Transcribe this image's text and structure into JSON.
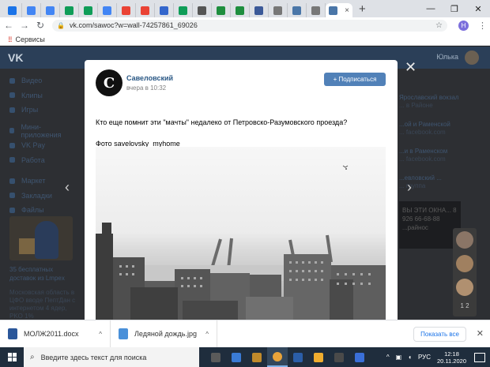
{
  "browser": {
    "tab_close": "×",
    "new_tab": "+",
    "tab_favicons": [
      "#1a73e8",
      "#4285f4",
      "#4285f4",
      "#0f9d58",
      "#0f9d58",
      "#4285f4",
      "#ea4335",
      "#ea4335",
      "#3366cc",
      "#0f9d58",
      "#555555",
      "#1e8e3e",
      "#1e8e3e",
      "#3b5998",
      "#777777",
      "#4a76a8",
      "#777777",
      "#4a76a8"
    ],
    "address": "vk.com/sawoc?w=wall-74257861_69026",
    "bookmarks_label": "Сервисы",
    "profile_initial": "Н",
    "minimize": "—",
    "restore": "❐",
    "close": "✕",
    "back": "←",
    "forward": "→",
    "reload": "↻"
  },
  "vk": {
    "logo": "VK",
    "user_name": "Юлька",
    "sidebar": [
      "Видео",
      "Клипы",
      "Игры",
      "Мини-приложения",
      "VK Pay",
      "Работа",
      "Маркет",
      "Закладки",
      "Файлы"
    ],
    "promo_title": "35 бесплатных доставок из Lmpex",
    "promo_text": "Московская область в ЦФО вводе ПептДан с интернетом 4 ядер, PKO 1%",
    "right_items": [
      {
        "title": "Ярославский вокзал",
        "desc": "... в Районе"
      },
      {
        "title": "...ой и Раменской",
        "desc": "... facebook.com"
      },
      {
        "title": "...и в Раменском",
        "desc": "... facebook.com"
      },
      {
        "title": "...евловский ...",
        "desc": "... группа"
      }
    ],
    "ad_text": "ВЫ ЭТИ ОКНА... 8 926 66-68-88 ...райнос",
    "friends_count": "1 2"
  },
  "post": {
    "author": "Савеловский",
    "time": "вчера в 10:32",
    "subscribe_label": "Подписаться",
    "text_line1": "Кто еще помнит эти \"мачты\" недалеко от Петровско-Разумовского проезда?",
    "text_line2": "Фото savelovsky_myhome",
    "avatar_letter": "C"
  },
  "downloads": {
    "items": [
      {
        "name": "МОЛЖ2011.docx",
        "color": "#2b579a"
      },
      {
        "name": "Ледяной дождь.jpg",
        "color": "#4a90d9"
      }
    ],
    "show_all": "Показать все",
    "close": "✕"
  },
  "taskbar": {
    "search_placeholder": "Введите здесь текст для поиска",
    "lang": "РУС",
    "time": "12:18",
    "date": "20.11.2020",
    "app_colors": [
      "#5a5a5a",
      "#3a7bd5",
      "#c08a2b",
      "#e8a33a",
      "#2b5ea8",
      "#f0ad2f",
      "#4a4a4a",
      "#3a6fd8"
    ]
  }
}
